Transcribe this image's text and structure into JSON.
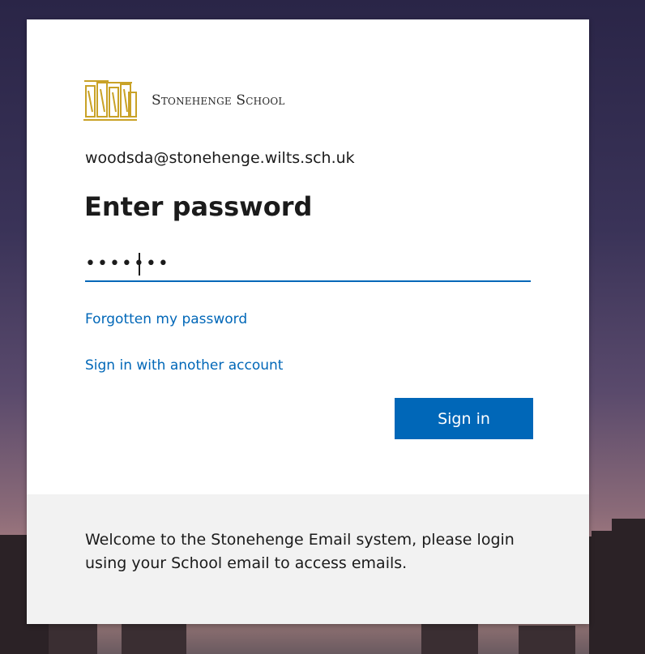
{
  "colors": {
    "accent": "#0067b8",
    "card": "#ffffff",
    "footer": "#f2f2f2",
    "text": "#1b1b1b"
  },
  "logo": {
    "icon": "stonehenge-logo-icon",
    "text": "Stonehenge School"
  },
  "identity": {
    "email": "woodsda@stonehenge.wilts.sch.uk"
  },
  "form": {
    "title": "Enter password",
    "password_value": "•••••••",
    "forgot_link": "Forgotten my password",
    "other_account_link": "Sign in with another account",
    "signin_label": "Sign in"
  },
  "footer": {
    "message": "Welcome to the Stonehenge Email system, please login using your School email to access emails."
  }
}
